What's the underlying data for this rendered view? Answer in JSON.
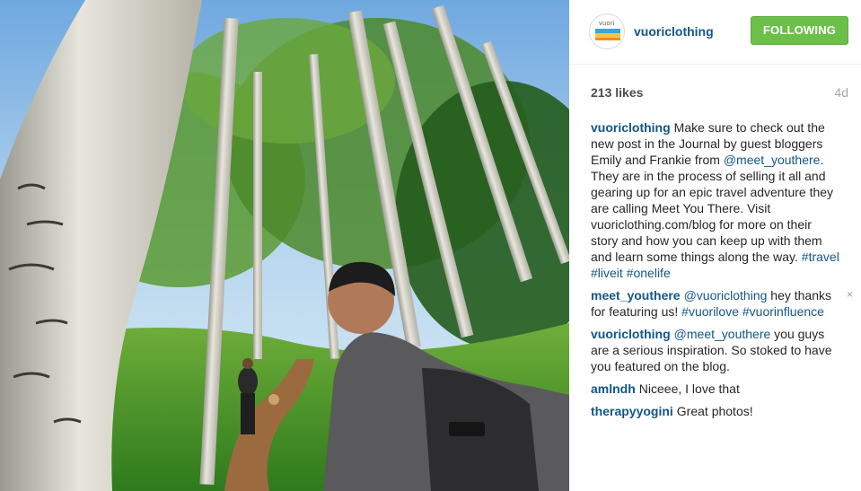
{
  "post": {
    "username": "vuoriclothing",
    "follow_label": "FOLLOWING",
    "avatar_brand": "vuori",
    "likes": "213 likes",
    "time": "4d"
  },
  "comments": [
    {
      "author": "vuoriclothing",
      "t1": "Make sure to check out the new post in the Journal by guest bloggers Emily and Frankie from ",
      "m1": "@meet_youthere",
      "t2": ". They are in the process of selling it all and gearing up for an epic travel adventure they are calling Meet You There. Visit vuoriclothing.com/blog for more on their story and how you can keep up with them and learn some things along the way. ",
      "h1": "#travel",
      "h2": "#liveit",
      "h3": "#onelife"
    },
    {
      "author": "meet_youthere",
      "m1": "@vuoriclothing",
      "t1": " hey thanks for featuring us! ",
      "h1": "#vuorilove",
      "h2": "#vuorinfluence",
      "close": "×"
    },
    {
      "author": "vuoriclothing",
      "m1": "@meet_youthere",
      "t1": " you guys are a serious inspiration. So stoked to have you featured on the blog."
    },
    {
      "author": "amlndh",
      "t1": "Niceee, I love that"
    },
    {
      "author": "therapyyogini",
      "t1": "Great photos!"
    }
  ],
  "colors": {
    "link": "#125688",
    "follow_green": "#6cc04a",
    "muted": "#a5a7aa"
  }
}
